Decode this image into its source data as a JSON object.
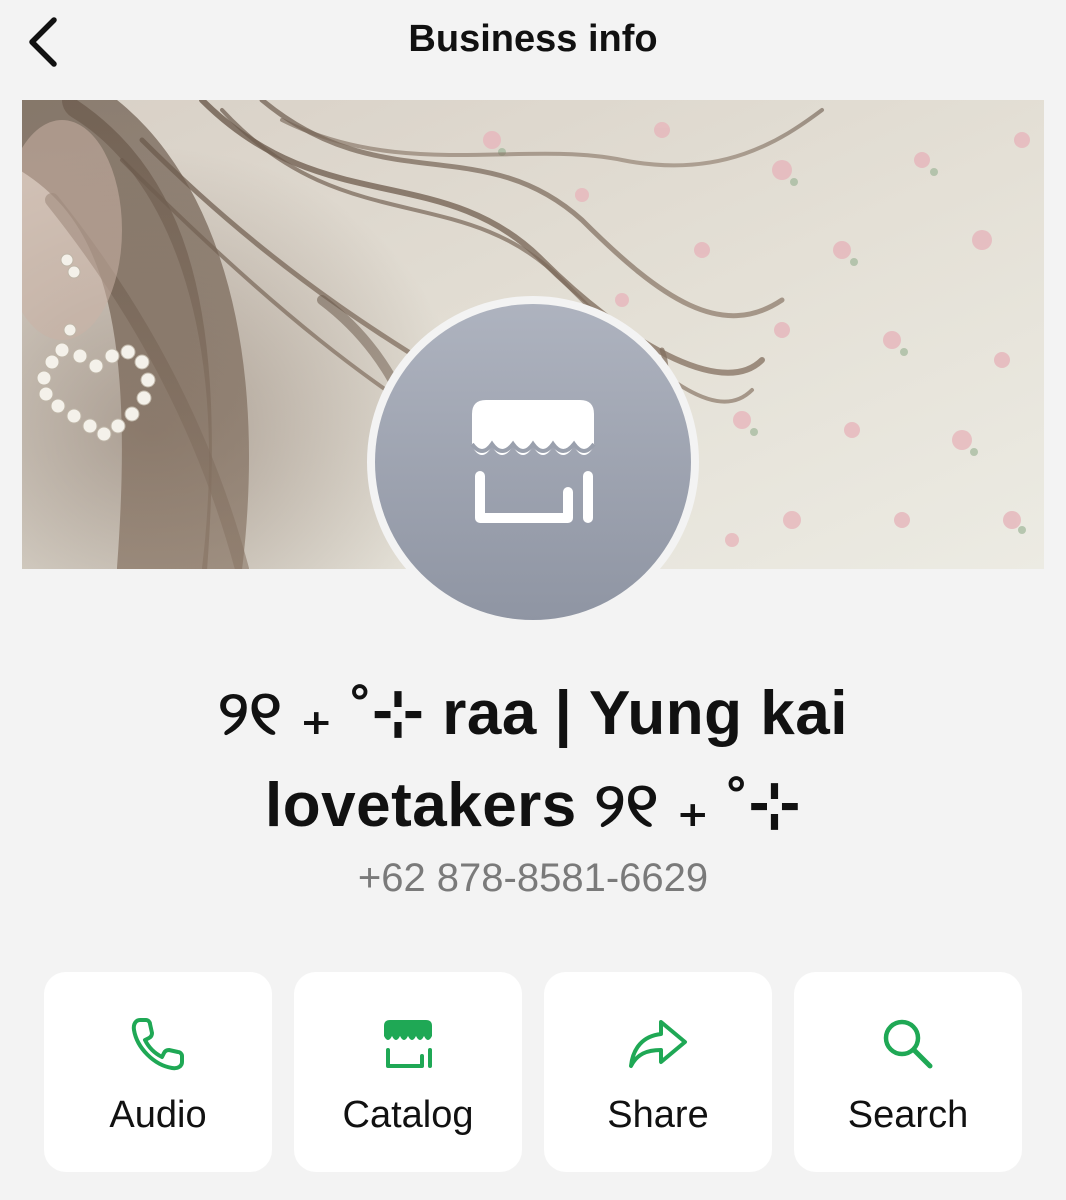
{
  "header": {
    "title": "Business info",
    "back_icon": "chevron-left-icon"
  },
  "profile": {
    "cover_description_icon": "cover-photo",
    "avatar_icon": "storefront-icon",
    "name_line1": "୨୧ ₊ ˚⊹ raa | Yung kai",
    "name_line2": "lovetakers ୨୧ ₊ ˚⊹",
    "phone": "+62 878-8581-6629"
  },
  "actions": [
    {
      "label": "Audio",
      "icon": "phone-icon"
    },
    {
      "label": "Catalog",
      "icon": "storefront-icon"
    },
    {
      "label": "Share",
      "icon": "share-arrow-icon"
    },
    {
      "label": "Search",
      "icon": "search-icon"
    }
  ],
  "colors": {
    "accent": "#1fa855",
    "background": "#f3f3f3",
    "card": "#ffffff",
    "avatar": "#9aa0ad",
    "secondary_text": "#7a7a7a"
  }
}
